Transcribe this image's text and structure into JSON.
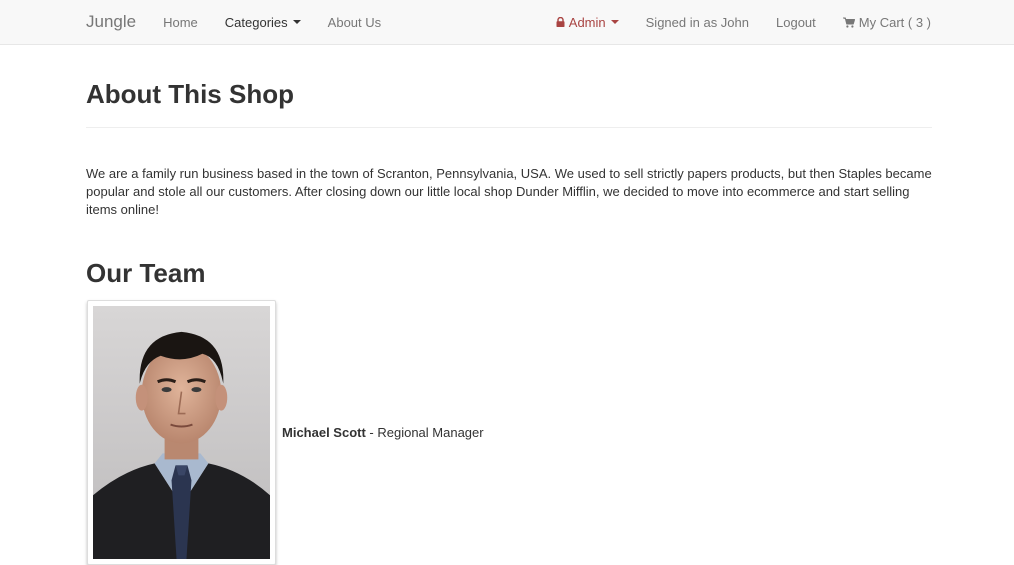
{
  "navbar": {
    "brand": "Jungle",
    "home": "Home",
    "categories": "Categories",
    "about": "About Us",
    "admin": "Admin",
    "signed_in": "Signed in as John",
    "logout": "Logout",
    "cart": "My Cart ( 3 )"
  },
  "page": {
    "title": "About This Shop",
    "intro": "We are a family run business based in the town of Scranton, Pennsylvania, USA. We used to sell strictly papers products, but then Staples became popular and stole all our customers. After closing down our little local shop Dunder Mifflin, we decided to move into ecommerce and start selling items online!",
    "team_title": "Our Team"
  },
  "team": [
    {
      "name": "Michael Scott",
      "separator": " - ",
      "role": "Regional Manager"
    }
  ],
  "colors": {
    "admin": "#a94442",
    "navbar_bg": "#f8f8f8"
  }
}
